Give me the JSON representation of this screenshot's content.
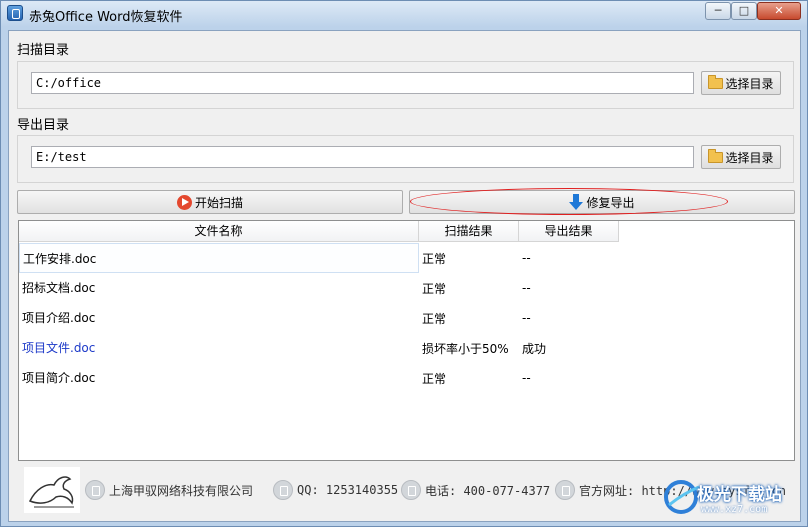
{
  "window": {
    "title": "赤兔Office Word恢复软件",
    "controls": {
      "minimize": "─",
      "maximize": "□",
      "close": "✕"
    }
  },
  "scan": {
    "label": "扫描目录",
    "path": "C:/office",
    "button": "选择目录"
  },
  "export": {
    "label": "导出目录",
    "path": "E:/test",
    "button": "选择目录"
  },
  "actions": {
    "start_scan": "开始扫描",
    "repair_export": "修复导出"
  },
  "table": {
    "columns": [
      "文件名称",
      "扫描结果",
      "导出结果"
    ],
    "rows": [
      {
        "name": "工作安排.doc",
        "scan": "正常",
        "export": "--"
      },
      {
        "name": "招标文档.doc",
        "scan": "正常",
        "export": "--"
      },
      {
        "name": "项目介绍.doc",
        "scan": "正常",
        "export": "--"
      },
      {
        "name": "项目文件.doc",
        "scan": "损坏率小于50%",
        "export": "成功"
      },
      {
        "name": "项目简介.doc",
        "scan": "正常",
        "export": "--"
      }
    ]
  },
  "footer": {
    "company": "上海甲驭网络科技有限公司",
    "qq": "QQ: 1253140355",
    "phone": "电话: 400-077-4377",
    "website": "官方网址: http://www.sysfix.cn"
  },
  "watermark": {
    "text": "极光下载站",
    "url": "www.xz7.com"
  },
  "colors": {
    "link_row": "#1c39c8",
    "highlight": "#e02020"
  }
}
